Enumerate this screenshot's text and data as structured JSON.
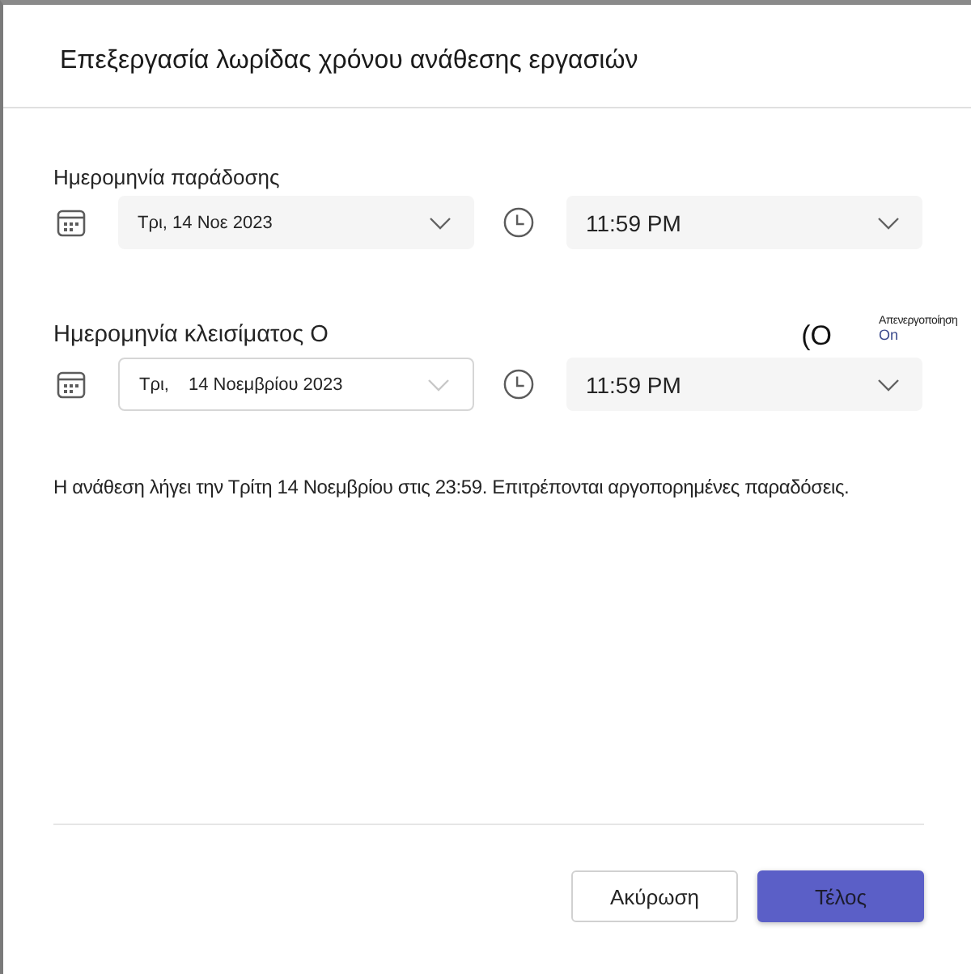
{
  "dialog": {
    "title": "Επεξεργασία λωρίδας χρόνου ανάθεσης εργασιών"
  },
  "sections": [
    {
      "label": "Ημερομηνία παράδοσης",
      "date": {
        "kind": "filled",
        "parts": [
          "Τρι, 14 Νοε 2023"
        ]
      },
      "time": {
        "kind": "filled",
        "value": "11:59 PM"
      }
    },
    {
      "label": "Ημερομηνία κλεισίματος O",
      "toggle": {
        "glyph": "(O",
        "caption": "Απενεργοποίηση",
        "state_text": "On"
      },
      "date": {
        "kind": "outlined",
        "parts": [
          "Τρι,",
          "14 Νοεμβρίου 2023"
        ]
      },
      "time": {
        "kind": "filled",
        "value": "11:59 PM"
      }
    }
  ],
  "summary": "Η ανάθεση λήγει την Τρίτη 14 Νοεμβρίου στις 23:59. Επιτρέπονται αργοπορημένες παραδόσεις.",
  "buttons": [
    {
      "label": "Ακύρωση",
      "kind": "secondary"
    },
    {
      "label": "Τέλος",
      "kind": "primary"
    }
  ]
}
